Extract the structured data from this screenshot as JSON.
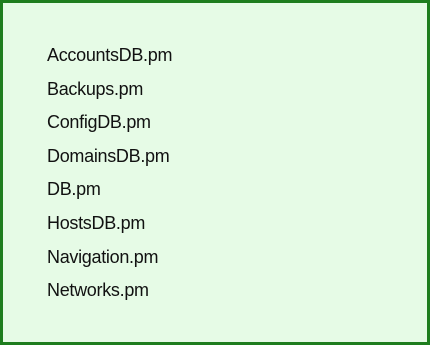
{
  "files": [
    "AccountsDB.pm",
    "Backups.pm",
    "ConfigDB.pm",
    "DomainsDB.pm",
    "DB.pm",
    "HostsDB.pm",
    "Navigation.pm",
    "Networks.pm"
  ],
  "colors": {
    "background": "#e6fbe6",
    "border": "#1e7d1e",
    "text": "#111111"
  }
}
